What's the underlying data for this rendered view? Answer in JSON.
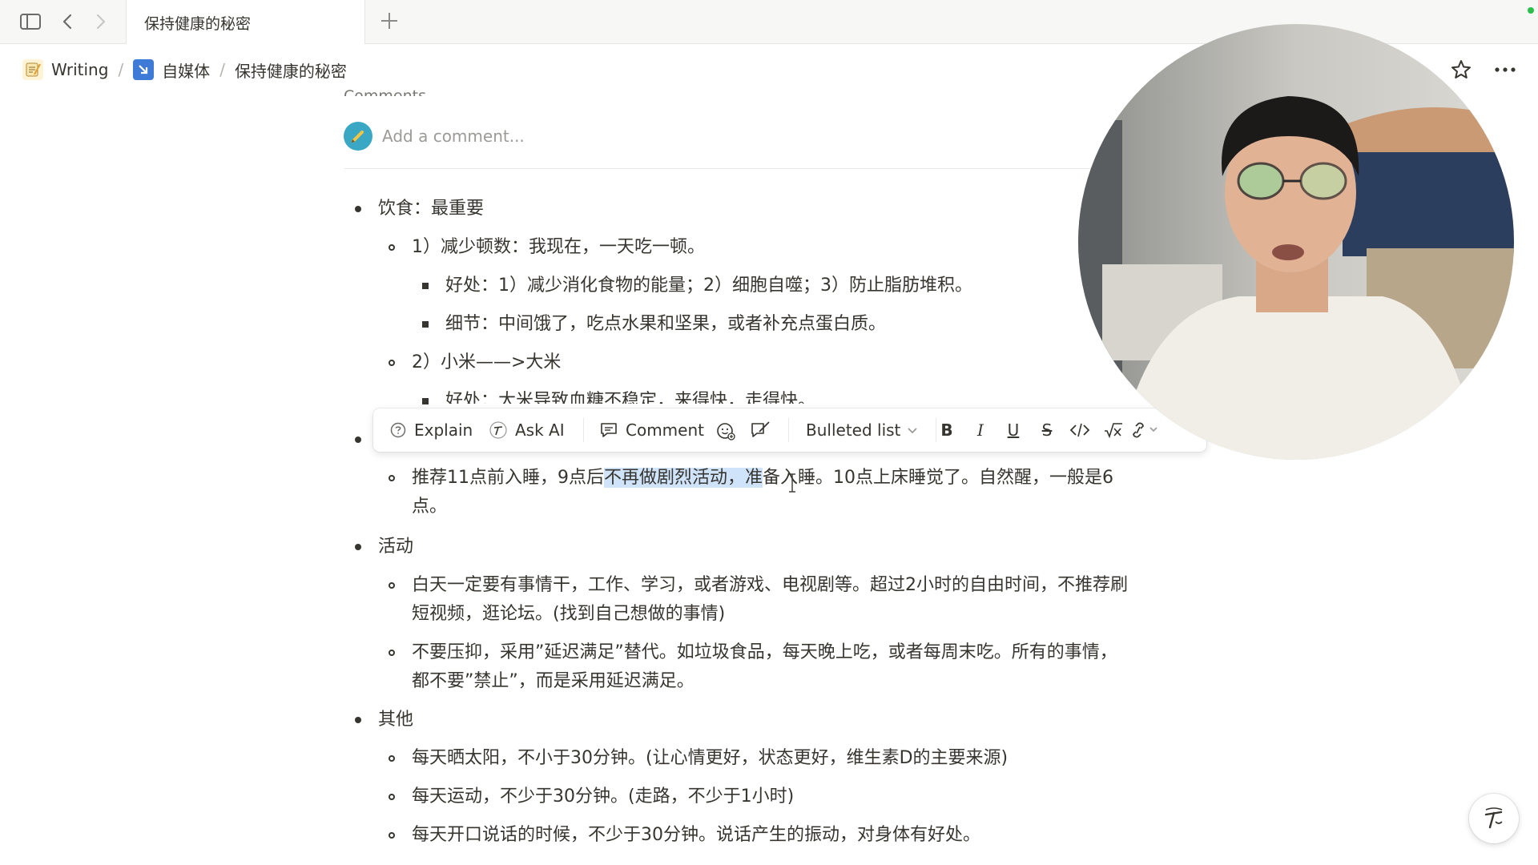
{
  "tab_bar": {
    "active_tab": "保持健康的秘密",
    "new_tab_icon": "plus-icon"
  },
  "breadcrumb": [
    {
      "label": "Writing",
      "icon": "memo-icon"
    },
    {
      "label": "自媒体",
      "icon": "arrow-box-icon"
    },
    {
      "label": "保持健康的秘密"
    }
  ],
  "comments": {
    "heading": "Comments",
    "placeholder": "Add a comment..."
  },
  "toolbar": {
    "explain": "Explain",
    "ask_ai": "Ask AI",
    "comment": "Comment",
    "block_type": "Bulleted list",
    "bold": "B",
    "italic": "I",
    "underline": "U",
    "strike": "S"
  },
  "document": {
    "diet": {
      "heading": "饮食：最重要",
      "item1": "1）减少顿数：我现在，一天吃一顿。",
      "item1_benefit": "好处：1）减少消化食物的能量；2）细胞自噬；3）防止脂肪堆积。",
      "item1_detail": "细节：中间饿了，吃点水果和坚果，或者补充点蛋白质。",
      "item2": "2）小米——>大米",
      "item2_benefit": "好处：大米导致血糖不稳定，来得快，走得快。"
    },
    "sleep": {
      "line1_before": "推荐11点前入睡，9点后",
      "line1_highlight": "不再做剧烈活动，准",
      "line1_after": "备入睡。10点上床睡觉了。自然醒，一般是6",
      "line2": "点。"
    },
    "activity": {
      "heading": "活动",
      "item1_line1": "白天一定要有事情干，工作、学习，或者游戏、电视剧等。超过2小时的自由时间，不推荐刷",
      "item1_line2": "短视频，逛论坛。(找到自己想做的事情)",
      "item2_line1": "不要压抑，采用”延迟满足”替代。如垃圾食品，每天晚上吃，或者每周末吃。所有的事情，",
      "item2_line2": "都不要”禁止”，而是采用延迟满足。"
    },
    "other": {
      "heading": "其他",
      "item1": "每天晒太阳，不小于30分钟。(让心情更好，状态更好，维生素D的主要来源)",
      "item2": "每天运动，不少于30分钟。(走路，不少于1小时)",
      "item3": "每天开口说话的时候，不少于30分钟。说话产生的振动，对身体有好处。"
    }
  },
  "colors": {
    "text": "#37352f",
    "highlight": "#cfe3fa",
    "tab_bar_bg": "#f7f7f5",
    "avatar": "#3aa8c4",
    "status_dot": "#2bbf4a"
  }
}
